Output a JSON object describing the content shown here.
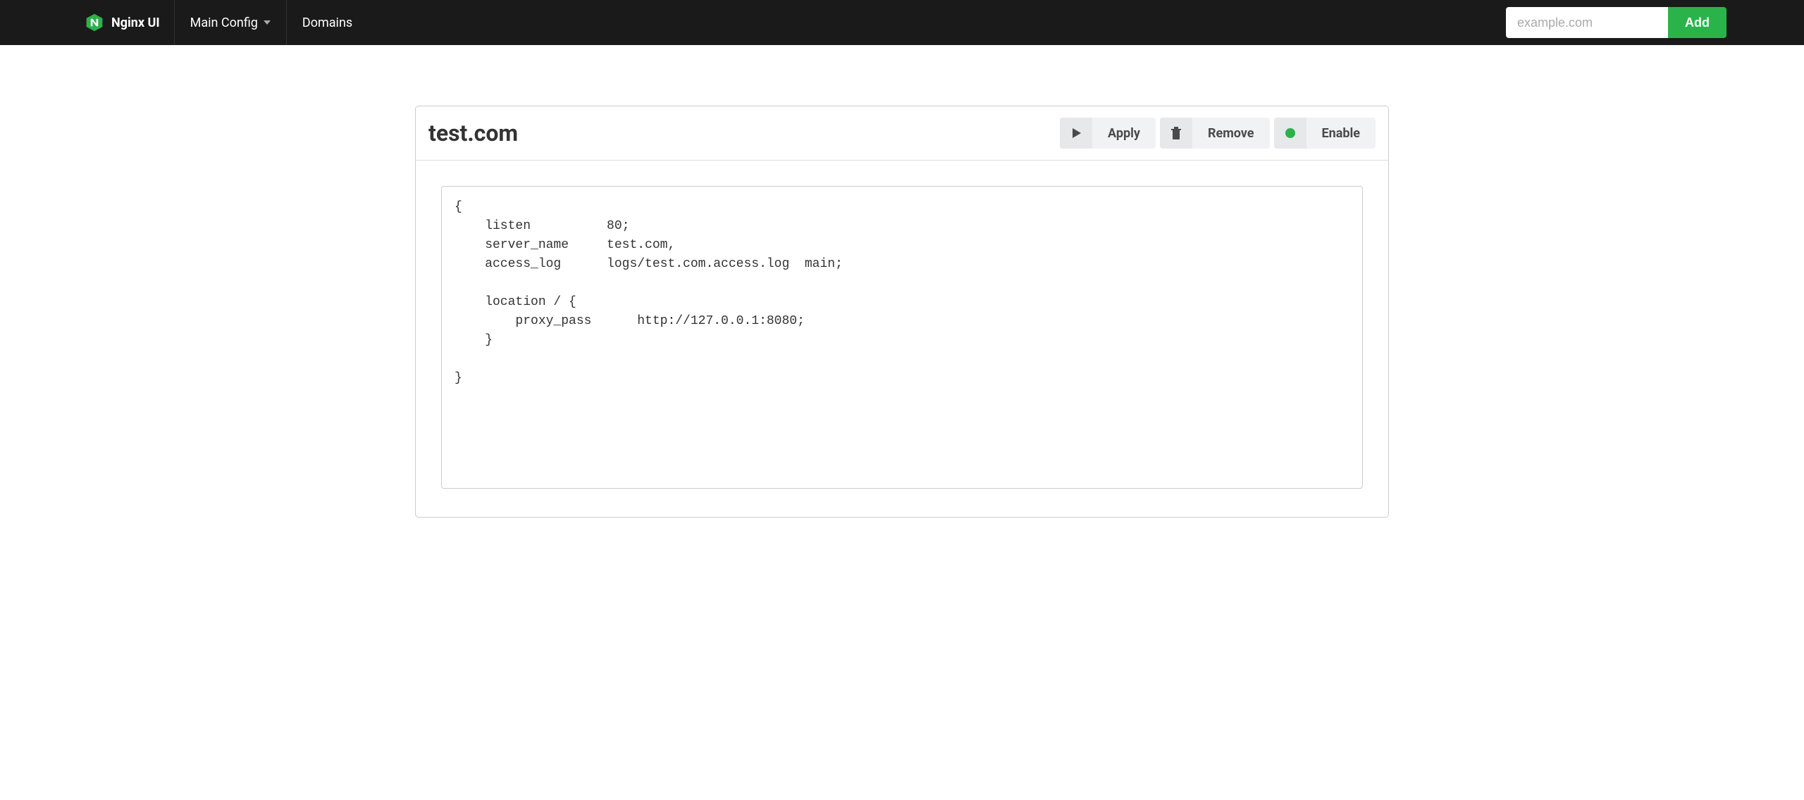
{
  "brand": {
    "name": "Nginx UI"
  },
  "nav": {
    "main_config": "Main Config",
    "domains": "Domains"
  },
  "add_form": {
    "placeholder": "example.com",
    "button": "Add"
  },
  "page": {
    "title": "test.com"
  },
  "toolbar": {
    "apply": "Apply",
    "remove": "Remove",
    "enable": "Enable"
  },
  "config": {
    "content": "{\n    listen          80;\n    server_name     test.com,\n    access_log      logs/test.com.access.log  main;\n\n    location / {\n        proxy_pass      http://127.0.0.1:8080;\n    }\n\n}"
  },
  "colors": {
    "accent": "#2ab34b",
    "navbar": "#1a1a1a"
  }
}
